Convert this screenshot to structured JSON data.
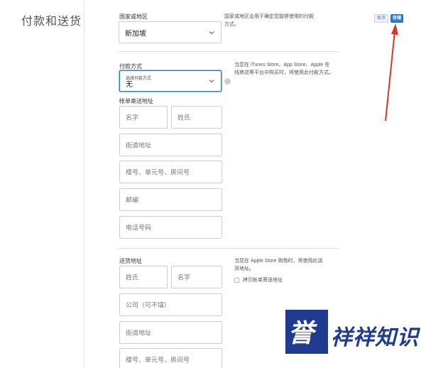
{
  "section": {
    "title": "付款和送货"
  },
  "header_buttons": {
    "cancel": "取消",
    "save": "存储"
  },
  "country": {
    "label": "国家或地区",
    "value": "新加坡",
    "help": [
      "国家或地区会用于确定您能够使用的付款",
      "方式。"
    ]
  },
  "payment": {
    "label": "付款方式",
    "mini_label": "选择付款方式",
    "value": "无",
    "help": [
      "当您在 iTunes Store、App Store、Apple 在",
      "线商店等平台中购买时，将使用此付款方式。"
    ]
  },
  "billing": {
    "label": "帐单寄送地址",
    "first_name": "名字",
    "last_name": "姓氏",
    "street": "街道地址",
    "unit": "楼号、单元号、房间号",
    "postal": "邮编",
    "phone": "电话号码"
  },
  "shipping": {
    "label": "送货地址",
    "last_name": "姓氏",
    "first_name": "名字",
    "company": "公司（可不填）",
    "street": "街道地址",
    "unit": "楼号、单元号、房间号",
    "help": [
      "当您在 Apple Store 购物时，将使用此送",
      "货地址。"
    ],
    "copy_billing": "拷贝帐单寄送地址"
  },
  "watermark": {
    "logo": "誉",
    "text": "祥祥知识"
  },
  "colors": {
    "accent": "#2f80d4",
    "arrow": "#d8342c",
    "watermark": "#1f3b8f"
  }
}
